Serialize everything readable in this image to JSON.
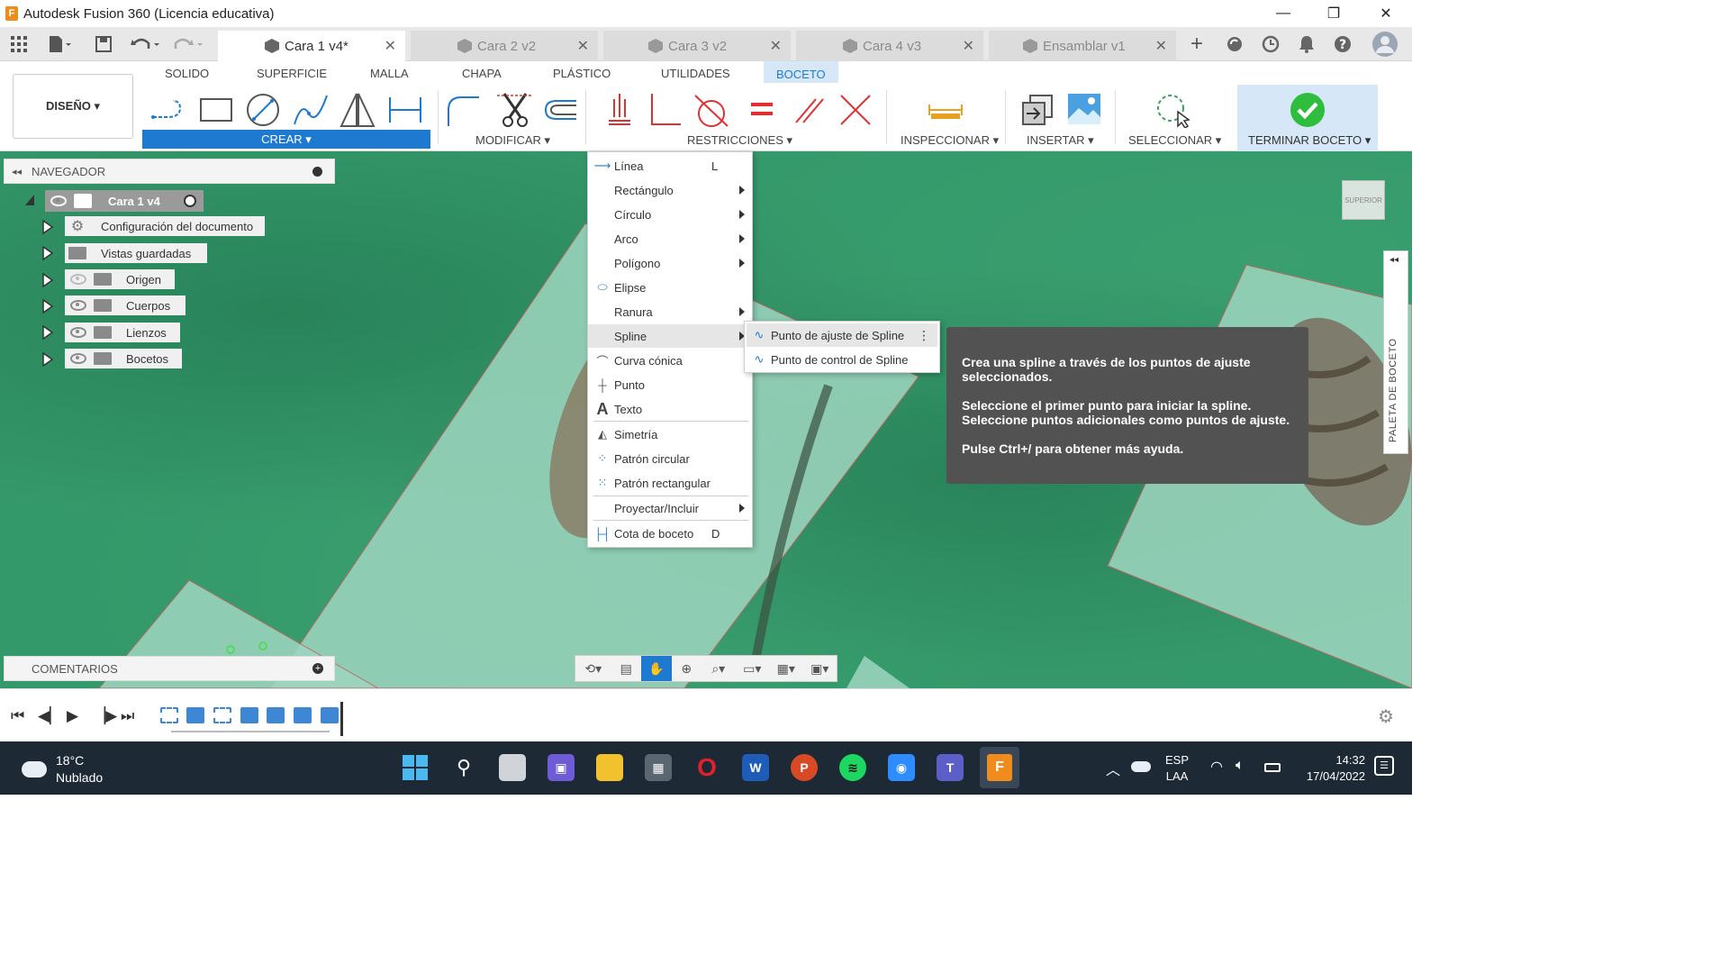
{
  "window": {
    "title": "Autodesk Fusion 360 (Licencia educativa)",
    "app_letter": "F",
    "controls": [
      "—",
      "❐",
      "✕"
    ]
  },
  "appbar": {
    "tabs": [
      {
        "label": "Cara 1 v4*",
        "active": true
      },
      {
        "label": "Cara 2 v2",
        "active": false
      },
      {
        "label": "Cara 3 v2",
        "active": false
      },
      {
        "label": "Cara 4 v3",
        "active": false
      },
      {
        "label": "Ensamblar v1",
        "active": false
      }
    ],
    "close_glyph": "✕",
    "add_tab": "+"
  },
  "toolbar": {
    "workspace": "DISEÑO ▾",
    "tabs": [
      "SOLIDO",
      "SUPERFICIE",
      "MALLA",
      "CHAPA",
      "PLÁSTICO",
      "UTILIDADES",
      "BOCETO"
    ],
    "active_tab": "BOCETO",
    "groups": {
      "crear": "CREAR ▾",
      "modificar": "MODIFICAR ▾",
      "restricciones": "RESTRICCIONES ▾",
      "inspeccionar": "INSPECCIONAR ▾",
      "insertar": "INSERTAR ▾",
      "seleccionar": "SELECCIONAR ▾",
      "terminar": "TERMINAR BOCETO ▾"
    },
    "accent": "#1e7ad0"
  },
  "navigator": {
    "title": "NAVEGADOR",
    "root": "Cara 1 v4",
    "items": [
      "Configuración del documento",
      "Vistas guardadas",
      "Origen",
      "Cuerpos",
      "Lienzos",
      "Bocetos"
    ]
  },
  "comments": {
    "title": "COMENTARIOS"
  },
  "crear_menu": {
    "items": [
      {
        "label": "Línea",
        "key": "L",
        "icon": "line-icon"
      },
      {
        "label": "Rectángulo",
        "submenu": true
      },
      {
        "label": "Círculo",
        "submenu": true
      },
      {
        "label": "Arco",
        "submenu": true
      },
      {
        "label": "Polígono",
        "submenu": true
      },
      {
        "label": "Elipse",
        "icon": "ellipse-icon"
      },
      {
        "label": "Ranura",
        "submenu": true
      },
      {
        "label": "Spline",
        "submenu": true,
        "highlighted": true
      },
      {
        "label": "Curva cónica",
        "icon": "conic-icon"
      },
      {
        "label": "Punto",
        "icon": "point-icon"
      },
      {
        "label": "Texto",
        "icon": "text-icon"
      },
      {
        "label": "Simetría",
        "icon": "mirror-icon"
      },
      {
        "label": "Patrón circular",
        "icon": "circular-pattern-icon"
      },
      {
        "label": "Patrón rectangular",
        "icon": "rect-pattern-icon"
      },
      {
        "label": "Proyectar/Incluir",
        "submenu": true
      },
      {
        "label": "Cota de boceto",
        "key": "D",
        "icon": "dimension-icon"
      }
    ]
  },
  "spline_submenu": {
    "items": [
      "Punto de ajuste de Spline",
      "Punto de control de Spline"
    ],
    "more_glyph": "⋮"
  },
  "tooltip": {
    "p1": "Crea una spline a través de los puntos de ajuste seleccionados.",
    "p2": "Seleccione el primer punto para iniciar la spline. Seleccione puntos adicionales como puntos de ajuste.",
    "p3": "Pulse Ctrl+/ para obtener más ayuda."
  },
  "viewcube": {
    "label": "SUPERIOR"
  },
  "palette": {
    "label": "PALETA DE BOCETO",
    "collapse": "◂◂"
  },
  "taskbar": {
    "temperature": "18°C",
    "weather": "Nublado",
    "lang1": "ESP",
    "lang2": "LAA",
    "time": "14:32",
    "date": "17/04/2022"
  }
}
